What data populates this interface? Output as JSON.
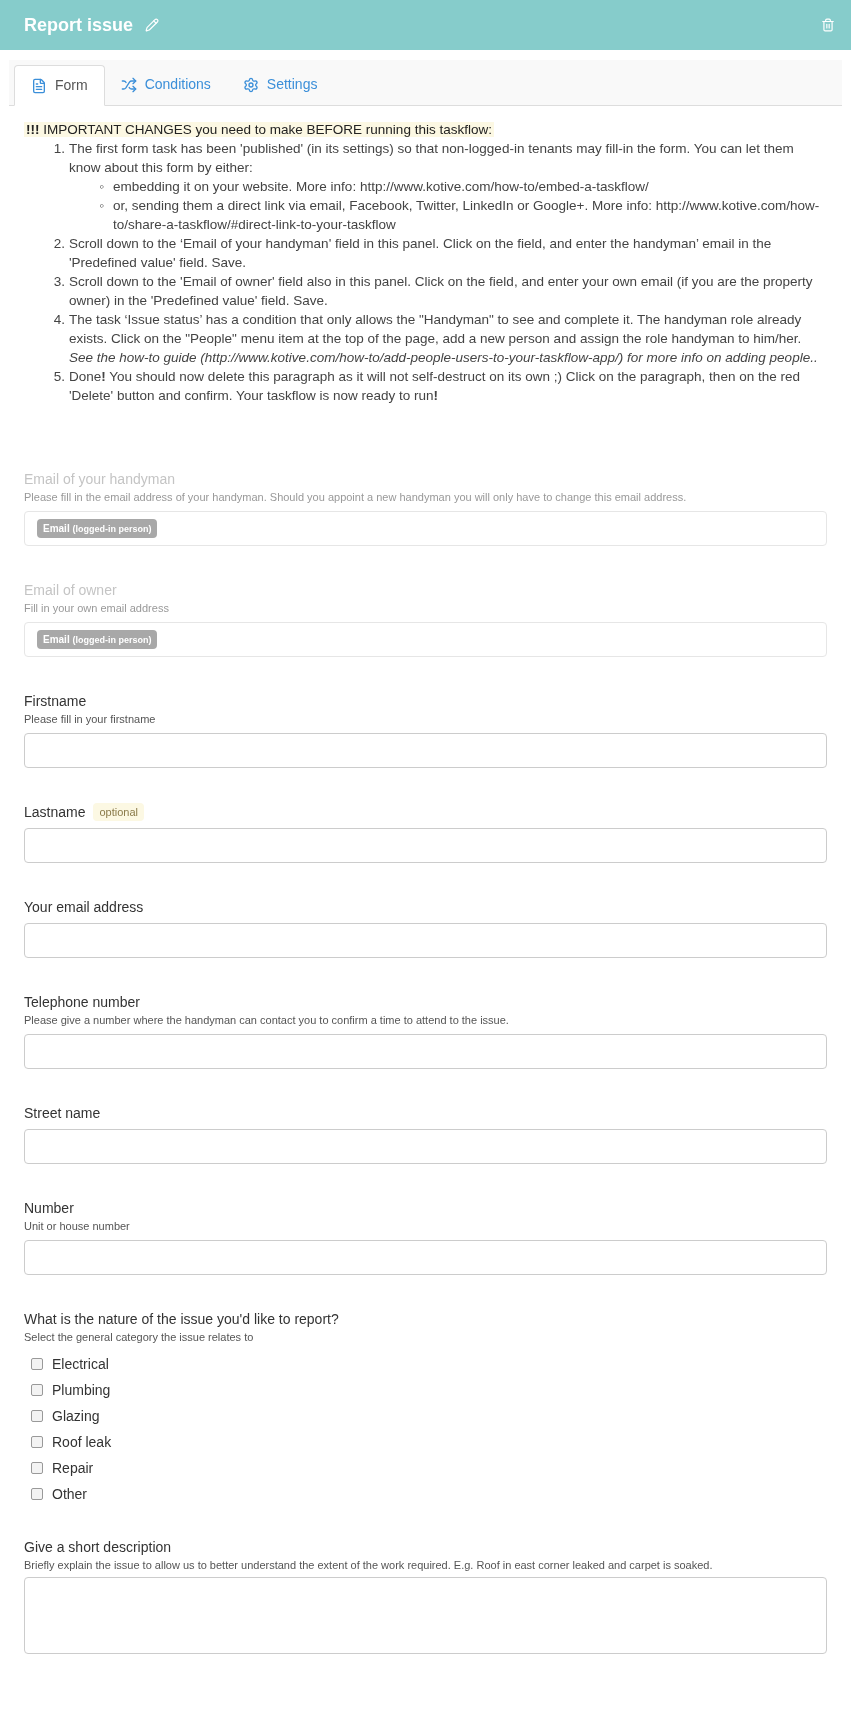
{
  "header": {
    "title": "Report issue"
  },
  "tabs": [
    {
      "label": "Form",
      "selected": true
    },
    {
      "label": "Conditions",
      "selected": false
    },
    {
      "label": "Settings",
      "selected": false
    }
  ],
  "notice": {
    "heading": "**!!!** IMPORTANT CHANGES you need to make BEFORE running this taskflow:",
    "steps": [
      {
        "marker": "1.",
        "text": "The first form task has been 'published' (in its settings) so that non-logged-in tenants may fill-in the form. You can let them know about this form by either:",
        "children": [
          {
            "marker": "◦",
            "text": "embedding it on your website. More info: http://www.kotive.com/how-to/embed-a-taskflow/"
          },
          {
            "marker": "◦",
            "text": "or, sending them a direct link via email, Facebook, Twitter, LinkedIn or Google+. More info: http://www.kotive.com/how-to/share-a-taskflow/#direct-link-to-your-taskflow"
          }
        ]
      },
      {
        "marker": "2.",
        "text": "Scroll down to the ‘Email of your handyman' field in this panel.  Click on the field, and enter the handyman’ email in the 'Predefined value' field. Save."
      },
      {
        "marker": "3.",
        "text": "Scroll down to the 'Email of owner' field also in this panel. Click on the field, and enter your own email (if you are the property owner) in the 'Predefined value' field. Save."
      },
      {
        "marker": "4.",
        "text": "The task ‘Issue status’ has a condition that only allows the \"Handyman\" to see and complete it. The handyman role already exists. Click on the \"People\" menu item at the top of the page, add a new person and assign the role handyman to him/her. *See the how-to guide (http://www.kotive.com/how-to/add-people-users-to-your-taskflow-app/) for more info on adding people..*"
      },
      {
        "marker": "5.",
        "text": "Done**!** You should now delete this paragraph as it will not self-destruct on its own ;) Click on the paragraph, then on the red 'Delete' button and confirm. Your taskflow is now ready to run**!**"
      }
    ]
  },
  "fields": [
    {
      "kind": "prefilled",
      "label": "Email of your handyman",
      "hint": "Please fill in the email address of your handyman. Should you appoint a new handyman you will only have to change this email address.",
      "disabled": true,
      "tag": "Email",
      "tag_note": "(logged-in person)"
    },
    {
      "kind": "prefilled",
      "label": "Email of owner",
      "hint": "Fill in your own email address",
      "disabled": true,
      "tag": "Email",
      "tag_note": "(logged-in person)"
    },
    {
      "kind": "text",
      "label": "Firstname",
      "hint": "Please fill in your firstname"
    },
    {
      "kind": "text",
      "label": "Lastname",
      "badge": "optional"
    },
    {
      "kind": "text",
      "label": "Your email address"
    },
    {
      "kind": "text",
      "label": "Telephone number",
      "hint": "Please give a number where the handyman can contact you to confirm a time to attend to the issue."
    },
    {
      "kind": "text",
      "label": "Street name"
    },
    {
      "kind": "text",
      "label": "Number",
      "hint": "Unit or house number"
    },
    {
      "kind": "checkboxes",
      "label": "What is the nature of the issue you'd like to report?",
      "hint": "Select the general category the issue relates to",
      "options": [
        {
          "label": "Electrical",
          "checked": false
        },
        {
          "label": "Plumbing",
          "checked": false
        },
        {
          "label": "Glazing",
          "checked": false
        },
        {
          "label": "Roof leak",
          "checked": false
        },
        {
          "label": "Repair",
          "checked": false
        },
        {
          "label": "Other",
          "checked": false
        }
      ]
    },
    {
      "kind": "textarea",
      "label": "Give a short description",
      "hint": "Briefly explain the issue to allow us to better understand the extent of the work required. E.g. Roof in east corner leaked and carpet is soaked."
    }
  ]
}
